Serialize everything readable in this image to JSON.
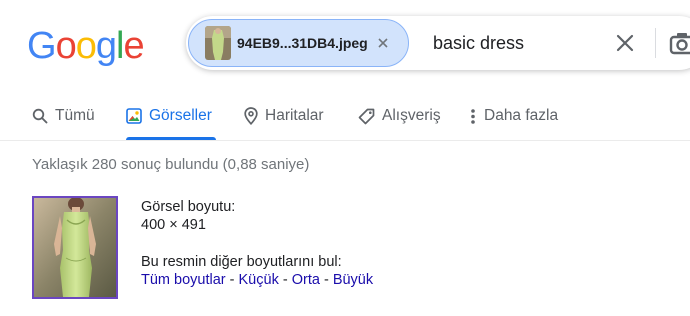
{
  "logo": {
    "letters": [
      "G",
      "o",
      "o",
      "g",
      "l",
      "e"
    ],
    "colors": [
      "#4285f4",
      "#ea4335",
      "#fbbc05",
      "#4285f4",
      "#34a853",
      "#ea4335"
    ]
  },
  "search": {
    "image_chip": {
      "filename": "94EB9...31DB4.jpeg"
    },
    "query": "basic dress"
  },
  "tabs": [
    {
      "label": "Tümü",
      "icon": "search-icon",
      "active": false
    },
    {
      "label": "Görseller",
      "icon": "image-icon",
      "active": true
    },
    {
      "label": "Haritalar",
      "icon": "map-pin-icon",
      "active": false
    },
    {
      "label": "Alışveriş",
      "icon": "tag-icon",
      "active": false
    },
    {
      "label": "Daha fazla",
      "icon": "more-vert-icon",
      "active": false
    }
  ],
  "results": {
    "stats": "Yaklaşık 280 sonuç bulundu (0,88 saniye)",
    "image_size_label": "Görsel boyutu:",
    "image_size_value": "400 × 491",
    "other_sizes_label": "Bu resmin diğer boyutlarını bul:",
    "size_links": {
      "all": "Tüm boyutlar",
      "small": "Küçük",
      "medium": "Orta",
      "large": "Büyük",
      "separator": " - "
    }
  },
  "colors": {
    "accent": "#1a73e8",
    "link": "#1a0dab",
    "chip_bg": "#d2e3fc",
    "thumb_border": "#6b46c1"
  }
}
